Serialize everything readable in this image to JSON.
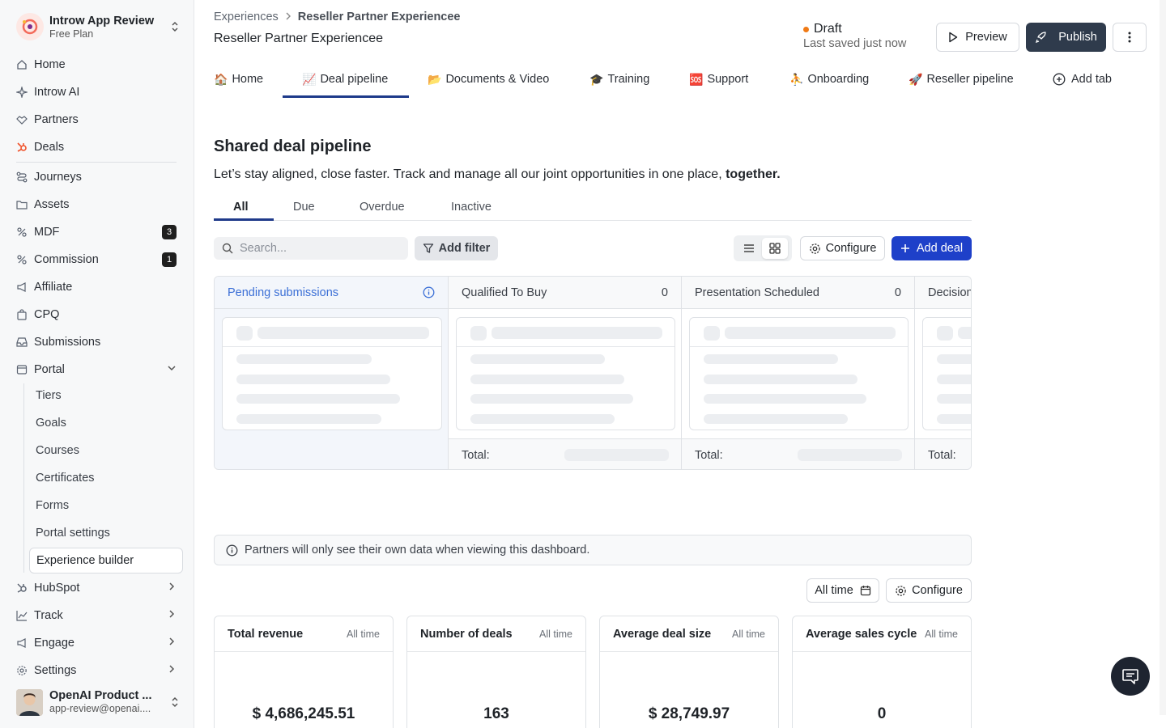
{
  "workspace": {
    "name": "Introw App Review",
    "plan": "Free Plan"
  },
  "sidebar": {
    "items": [
      {
        "label": "Home"
      },
      {
        "label": "Introw AI"
      },
      {
        "label": "Partners"
      },
      {
        "label": "Deals"
      },
      {
        "label": "Journeys"
      },
      {
        "label": "Assets"
      },
      {
        "label": "MDF",
        "badge": "3"
      },
      {
        "label": "Commission",
        "badge": "1"
      },
      {
        "label": "Affiliate"
      },
      {
        "label": "CPQ"
      },
      {
        "label": "Submissions"
      },
      {
        "label": "Portal"
      }
    ],
    "portal_sub": [
      {
        "label": "Tiers"
      },
      {
        "label": "Goals"
      },
      {
        "label": "Courses"
      },
      {
        "label": "Certificates"
      },
      {
        "label": "Forms"
      },
      {
        "label": "Portal settings"
      },
      {
        "label": "Experience builder"
      }
    ],
    "bottom": [
      {
        "label": "HubSpot"
      },
      {
        "label": "Track"
      },
      {
        "label": "Engage"
      },
      {
        "label": "Settings"
      }
    ],
    "user": {
      "name": "OpenAI Product ...",
      "email": "app-review@openai...."
    }
  },
  "header": {
    "breadcrumb": [
      "Experiences",
      "Reseller Partner Experiencee"
    ],
    "title": "Reseller Partner Experiencee",
    "status": "Draft",
    "saved": "Last saved just now",
    "preview_label": "Preview",
    "publish_label": "Publish"
  },
  "tabs": [
    {
      "emoji": "🏠",
      "label": "Home"
    },
    {
      "emoji": "📈",
      "label": "Deal pipeline"
    },
    {
      "emoji": "📂",
      "label": "Documents & Video"
    },
    {
      "emoji": "🎓",
      "label": "Training"
    },
    {
      "emoji": "🆘",
      "label": "Support"
    },
    {
      "emoji": "⛹",
      "label": "Onboarding"
    },
    {
      "emoji": "🚀",
      "label": "Reseller pipeline"
    },
    {
      "emoji": "",
      "label": "Add tab"
    }
  ],
  "main": {
    "heading": "Shared deal pipeline",
    "subtitle_pre": "Let’s stay aligned, close faster. Track and manage all our joint opportunities in one place, ",
    "subtitle_bold": "together.",
    "filter_tabs": [
      "All",
      "Due",
      "Overdue",
      "Inactive"
    ],
    "search_placeholder": "Search...",
    "add_filter_label": "Add filter",
    "configure_label": "Configure",
    "add_deal_label": "Add deal",
    "columns": [
      {
        "name": "Pending submissions",
        "count": ""
      },
      {
        "name": "Qualified To Buy",
        "count": "0"
      },
      {
        "name": "Presentation Scheduled",
        "count": "0"
      },
      {
        "name": "Decision",
        "count": ""
      }
    ],
    "total_label": "Total:",
    "notice": "Partners will only see their own data when viewing this dashboard.",
    "time_filter": "All time",
    "stats": [
      {
        "title": "Total revenue",
        "range": "All time",
        "value": "$ 4,686,245.51"
      },
      {
        "title": "Number of deals",
        "range": "All time",
        "value": "163"
      },
      {
        "title": "Average deal size",
        "range": "All time",
        "value": "$ 28,749.97"
      },
      {
        "title": "Average sales cycle",
        "range": "All time",
        "value": "0"
      }
    ]
  },
  "colors": {
    "accent": "#1e40c9",
    "publish": "#2f3b4c",
    "draft_dot": "#f07a16",
    "tab_underline": "#1e3a8a"
  }
}
